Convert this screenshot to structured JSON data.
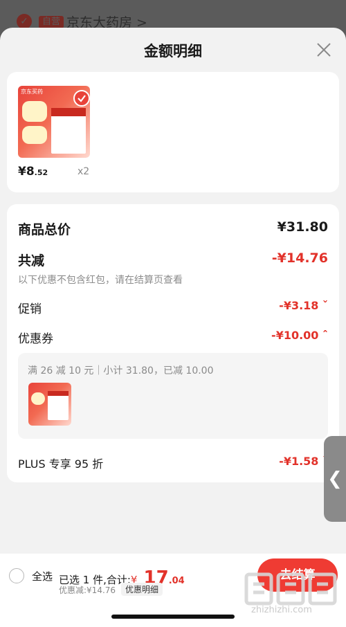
{
  "background": {
    "store_badge": "自营",
    "store_name": "京东大药房 >"
  },
  "sheet": {
    "title": "金额明细"
  },
  "product": {
    "thumb_brand": "京东买药",
    "price_main": "¥8",
    "price_fraction": ".52",
    "quantity": "x2"
  },
  "breakdown": {
    "total_label": "商品总价",
    "total_value": "¥31.80",
    "reduce_label": "共减",
    "reduce_value": "-¥14.76",
    "note": "以下优惠不包含红包，请在结算页查看",
    "promo_label": "促销",
    "promo_value": "-¥3.18 ˇ",
    "coupon_label": "优惠券",
    "coupon_value": "-¥10.00 ˆ",
    "coupon_desc": "满 26 减 10 元｜小计 31.80，已减 10.00",
    "plus_label": "PLUS 专享 95 折",
    "plus_value": "-¥1.58 ˇ"
  },
  "bottom": {
    "select_all": "全选",
    "selected_text": "已选 1 件,合计:",
    "currency": "¥",
    "total_main": " 17",
    "total_fraction": ".04",
    "discount_text": "优惠减:¥14.76",
    "detail_chip": "优惠明细",
    "checkout_label": "去结算"
  },
  "watermark": {
    "subtext": "zhizhizhi.com"
  },
  "colors": {
    "accent_red": "#e2322a",
    "checkout_red": "#ef3b33"
  }
}
